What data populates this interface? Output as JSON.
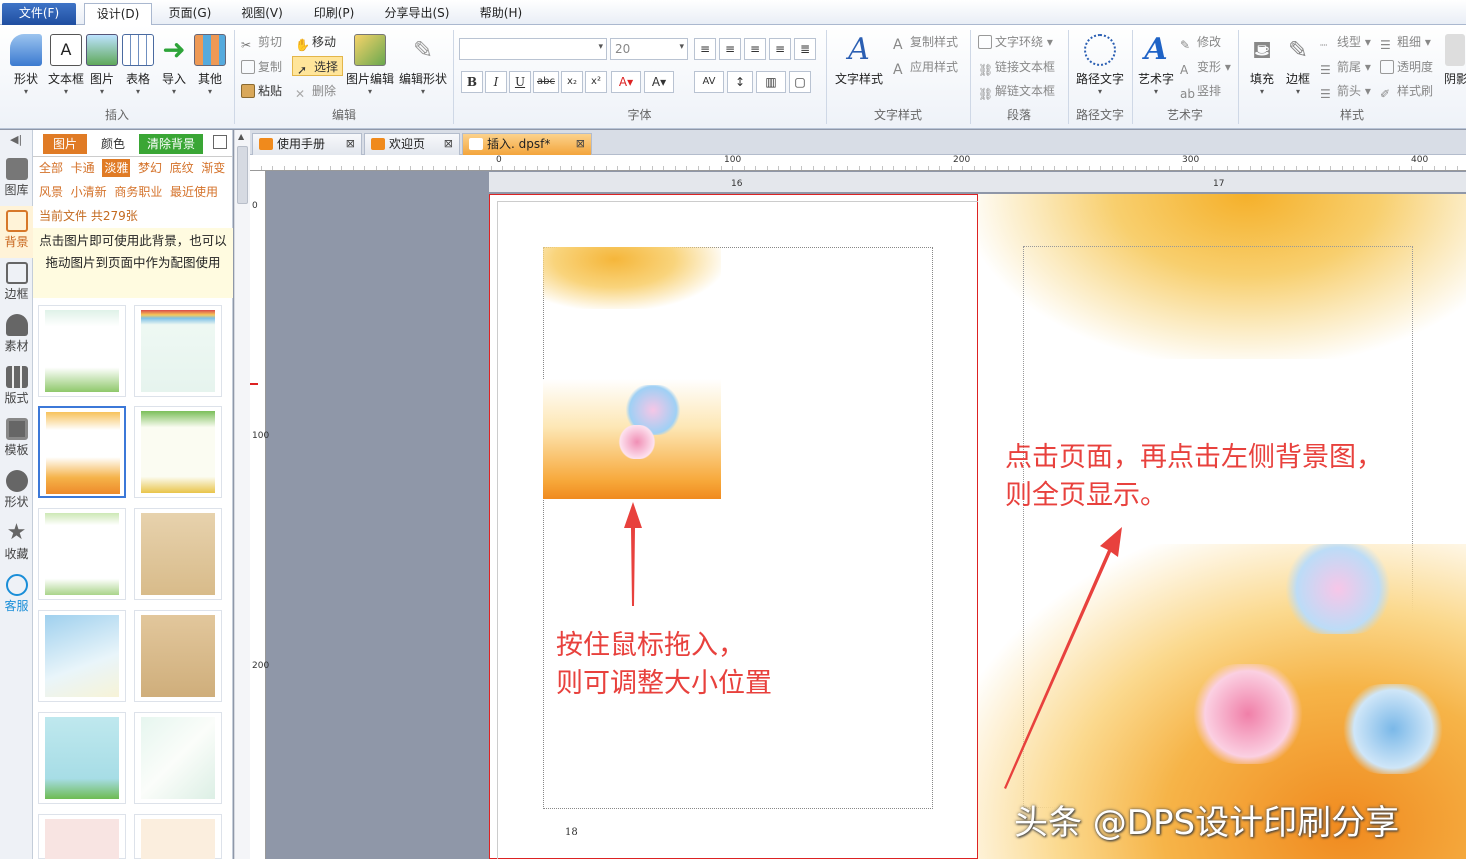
{
  "menu": [
    "文件(F)",
    "设计(D)",
    "页面(G)",
    "视图(V)",
    "印刷(P)",
    "分享导出(S)",
    "帮助(H)"
  ],
  "ribbon": {
    "insert": {
      "label": "插入",
      "shape": "形状",
      "textbox": "文本框",
      "image": "图片",
      "table": "表格",
      "import": "导入",
      "other": "其他"
    },
    "edit": {
      "label": "编辑",
      "cut": "剪切",
      "copy": "复制",
      "paste": "粘贴",
      "move": "移动",
      "select": "选择",
      "delete": "删除",
      "image_edit": "图片编辑",
      "edit_shape": "编辑形状"
    },
    "font": {
      "label": "字体",
      "font_name": "",
      "font_size": "20",
      "bold": "B",
      "italic": "I",
      "underline": "U",
      "strike": "abc"
    },
    "text_style": {
      "label": "文字样式",
      "big": "文字样式",
      "copy_style": "复制样式",
      "apply_style": "应用样式"
    },
    "paragraph": {
      "label": "段落",
      "wrap": "文字环绕",
      "link": "链接文本框",
      "unlink": "解链文本框"
    },
    "path_text": {
      "label": "路径文字",
      "big": "路径文字"
    },
    "art_text": {
      "label": "艺术字",
      "big": "艺术字",
      "modify": "修改",
      "transform": "变形",
      "vertical": "竖排"
    },
    "style": {
      "label": "样式",
      "fill": "填充",
      "border": "边框",
      "line_type": "线型",
      "arrow_tail": "箭尾",
      "arrow_head": "箭头",
      "thickness": "粗细",
      "opacity": "透明度",
      "brush": "样式刷",
      "shadow": "阴影"
    }
  },
  "iconbar": [
    "图库",
    "背景",
    "边框",
    "素材",
    "版式",
    "模板",
    "形状",
    "收藏",
    "客服"
  ],
  "panel": {
    "tabs": [
      "图片",
      "颜色",
      "清除背景"
    ],
    "categories_row1": [
      "全部",
      "卡通",
      "淡雅",
      "梦幻",
      "底纹",
      "渐变"
    ],
    "categories_row2": [
      "风景",
      "小清新",
      "商务职业",
      "最近使用"
    ],
    "file_info": "当前文件  共279张",
    "hint": "点击图片即可使用此背景，也可以拖动图片到页面中作为配图使用"
  },
  "doc_tabs": [
    "使用手册",
    "欢迎页",
    "插入. dpsf*"
  ],
  "ruler": {
    "h": [
      "0",
      "100",
      "200",
      "300",
      "400"
    ],
    "v": [
      "0",
      "100",
      "200"
    ],
    "page_nums": [
      "16",
      "17"
    ]
  },
  "canvas": {
    "page_number": "18",
    "annotation_left": [
      "按住鼠标拖入，",
      "则可调整大小位置"
    ],
    "annotation_right": [
      "点击页面，再点击左侧背景图，",
      "则全页显示。"
    ],
    "watermark": "头条 @DPS设计印刷分享"
  },
  "colors": {
    "accent": "#2b5fb3",
    "annotation": "#e8413d",
    "tab_active": "#f0a23a"
  }
}
